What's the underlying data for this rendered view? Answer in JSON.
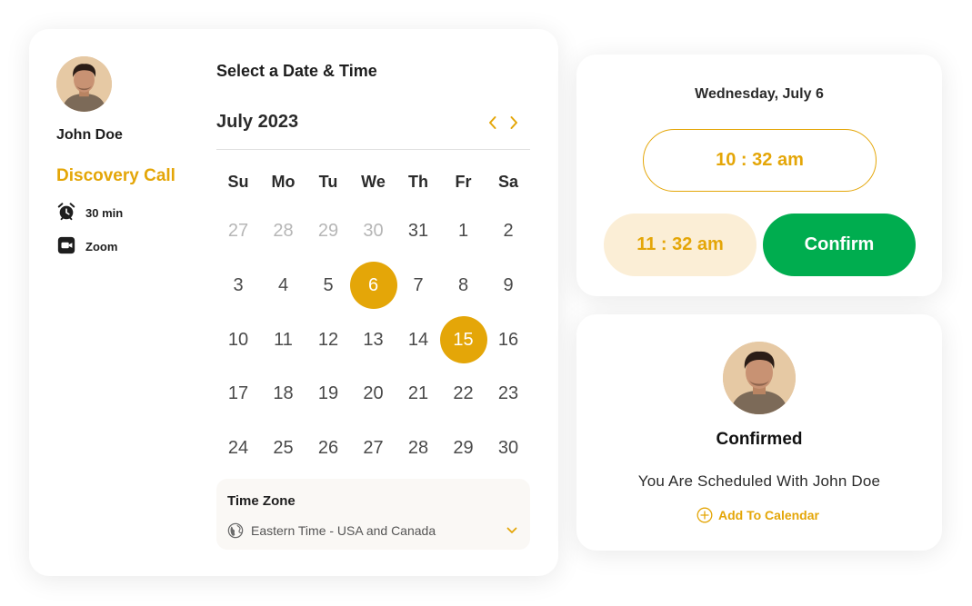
{
  "host": {
    "name": "John Doe",
    "event_title": "Discovery Call",
    "duration": "30 min",
    "location": "Zoom"
  },
  "calendar": {
    "heading": "Select a Date & Time",
    "month_label": "July 2023",
    "weekdays": [
      "Su",
      "Mo",
      "Tu",
      "We",
      "Th",
      "Fr",
      "Sa"
    ],
    "weeks": [
      [
        {
          "d": "27",
          "muted": true
        },
        {
          "d": "28",
          "muted": true
        },
        {
          "d": "29",
          "muted": true
        },
        {
          "d": "30",
          "muted": true
        },
        {
          "d": "31"
        },
        {
          "d": "1"
        },
        {
          "d": "2"
        }
      ],
      [
        {
          "d": "3"
        },
        {
          "d": "4"
        },
        {
          "d": "5"
        },
        {
          "d": "6",
          "selected": true
        },
        {
          "d": "7"
        },
        {
          "d": "8"
        },
        {
          "d": "9"
        }
      ],
      [
        {
          "d": "10"
        },
        {
          "d": "11"
        },
        {
          "d": "12"
        },
        {
          "d": "13"
        },
        {
          "d": "14"
        },
        {
          "d": "15",
          "selected": true
        },
        {
          "d": "16"
        }
      ],
      [
        {
          "d": "17"
        },
        {
          "d": "18"
        },
        {
          "d": "19"
        },
        {
          "d": "20"
        },
        {
          "d": "21"
        },
        {
          "d": "22"
        },
        {
          "d": "23"
        }
      ],
      [
        {
          "d": "24"
        },
        {
          "d": "25"
        },
        {
          "d": "26"
        },
        {
          "d": "27"
        },
        {
          "d": "28"
        },
        {
          "d": "29"
        },
        {
          "d": "30"
        }
      ]
    ]
  },
  "timezone": {
    "label": "Time Zone",
    "value": "Eastern Time - USA and Canada"
  },
  "time_picker": {
    "date": "Wednesday, July 6",
    "slot_1": "10 : 32 am",
    "slot_2": "11 : 32 am",
    "confirm_label": "Confirm"
  },
  "confirmation": {
    "title": "Confirmed",
    "message": "You Are Scheduled With John Doe",
    "add_to_calendar": "Add To Calendar"
  },
  "colors": {
    "accent": "#e4a608",
    "accent_light": "#fbeed6",
    "confirm_green": "#00ad4f",
    "text_dark": "#1e1e1e",
    "muted": "#b6b6b6"
  },
  "icons": [
    "alarm-clock-icon",
    "zoom-icon",
    "chevron-left-icon",
    "chevron-right-icon",
    "globe-icon",
    "chevron-down-icon",
    "plus-circle-icon"
  ]
}
